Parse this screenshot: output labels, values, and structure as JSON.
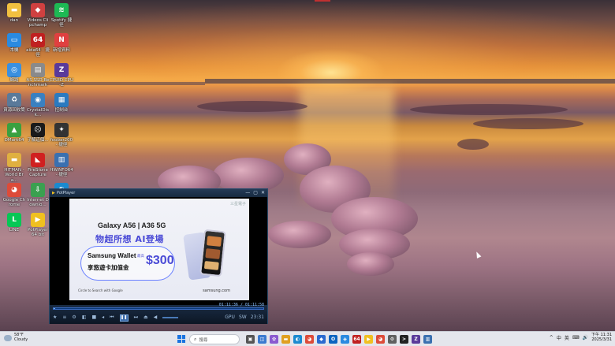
{
  "desktop": {
    "icons": [
      {
        "id": "folder-dan",
        "label": "dan",
        "icon": "folder-icon",
        "color": "#f2c040",
        "glyph": "▬"
      },
      {
        "id": "ms-store",
        "label": "Videos Clipchamp",
        "icon": "store-icon",
        "color": "#d04040",
        "glyph": "◆"
      },
      {
        "id": "spotify",
        "label": "Spotify\n捷徑",
        "icon": "spotify-icon",
        "color": "#1db954",
        "glyph": "≋"
      },
      {
        "id": "desktop-pc",
        "label": "本機",
        "icon": "computer-icon",
        "color": "#2a8ae0",
        "glyph": "▭"
      },
      {
        "id": "aida64",
        "label": "aida64 - 捷徑",
        "icon": "aida64-icon",
        "color": "#c02020",
        "glyph": "64"
      },
      {
        "id": "app-new",
        "label": "新增資料",
        "icon": "new-app-icon",
        "color": "#e04040",
        "glyph": "N"
      },
      {
        "id": "network",
        "label": "網路",
        "icon": "network-icon",
        "color": "#3a90e0",
        "glyph": "◎"
      },
      {
        "id": "as-ssd",
        "label": "AS SSD Benchmark",
        "icon": "ssd-icon",
        "color": "#8a8a8a",
        "glyph": "▤"
      },
      {
        "id": "cpuid",
        "label": "CPUID CPU-Z",
        "icon": "cpuz-icon",
        "color": "#5a3a9a",
        "glyph": "Z"
      },
      {
        "id": "recycle",
        "label": "資源回收筒",
        "icon": "recycle-bin-icon",
        "color": "#5a7a9a",
        "glyph": "♻"
      },
      {
        "id": "crystaldisk",
        "label": "CrystalDisk...",
        "icon": "crystaldisk-icon",
        "color": "#3a80c0",
        "glyph": "◉"
      },
      {
        "id": "control-panel",
        "label": "控制台",
        "icon": "control-panel-icon",
        "color": "#2a7ac0",
        "glyph": "▦"
      },
      {
        "id": "dmark",
        "label": "DMark64",
        "icon": "dmark-icon",
        "color": "#3aa040",
        "glyph": "▲"
      },
      {
        "id": "uninstall",
        "label": "了解這個...",
        "icon": "help-icon",
        "color": "#1a1a1a",
        "glyph": "☹"
      },
      {
        "id": "foobar",
        "label": "foobar200 - 捷徑",
        "icon": "foobar-icon",
        "color": "#333333",
        "glyph": "✦"
      },
      {
        "id": "hitman",
        "label": "HITMAN - World Bra...",
        "icon": "folder-icon",
        "color": "#e0b040",
        "glyph": "▬"
      },
      {
        "id": "firestone",
        "label": "FireStone Capture",
        "icon": "firestone-icon",
        "color": "#d02020",
        "glyph": "◣"
      },
      {
        "id": "hwinfo",
        "label": "HWiNFO64 - 捷徑",
        "icon": "hwinfo-icon",
        "color": "#3a70b0",
        "glyph": "▥"
      },
      {
        "id": "chrome",
        "label": "Google Chrome",
        "icon": "chrome-icon",
        "color": "#dd4b39",
        "glyph": "◕"
      },
      {
        "id": "idm",
        "label": "Internet Downlo...",
        "icon": "idm-icon",
        "color": "#3aa050",
        "glyph": "⇩"
      },
      {
        "id": "edge",
        "label": "Microsoft Edge",
        "icon": "edge-icon",
        "color": "#1a8ad0",
        "glyph": "◐"
      },
      {
        "id": "line",
        "label": "LINE",
        "icon": "line-icon",
        "color": "#06c755",
        "glyph": "L"
      },
      {
        "id": "potplayer",
        "label": "PotPlayer 64 bit",
        "icon": "potplayer-icon",
        "color": "#f0c020",
        "glyph": "▶"
      }
    ]
  },
  "player": {
    "title": "PotPlayer",
    "time": "01:11:36 / 01:11:58",
    "ad": {
      "corner": "三星電子",
      "model": "Galaxy A56 | A36 5G",
      "headline": "物超所想 AI登場",
      "wallet": "Samsung Wallet",
      "sub": "享悠遊卡加值金",
      "upto": "最高",
      "amount": "$300",
      "circle": "Circle to Search with Google",
      "site": "samsung.com"
    },
    "right_labels": [
      "GPU",
      "SW",
      "23:31"
    ]
  },
  "taskbar": {
    "weather_temp": "58°F",
    "weather_desc": "Cloudy",
    "search_placeholder": "搜尋",
    "apps": [
      {
        "icon": "task-view-icon",
        "color": "#555555",
        "glyph": "▣"
      },
      {
        "icon": "widgets-icon",
        "color": "#3a7ad0",
        "glyph": "◫"
      },
      {
        "icon": "copilot-icon",
        "color": "#8a5ad0",
        "glyph": "✿"
      },
      {
        "icon": "file-explorer-icon",
        "color": "#e0a020",
        "glyph": "▬"
      },
      {
        "icon": "edge-icon",
        "color": "#1a8ad0",
        "glyph": "◐"
      },
      {
        "icon": "chrome-icon",
        "color": "#dd4b39",
        "glyph": "◕"
      },
      {
        "icon": "store-icon",
        "color": "#2a6ad0",
        "glyph": "◆"
      },
      {
        "icon": "outlook-icon",
        "color": "#0a64c0",
        "glyph": "O"
      },
      {
        "icon": "photos-icon",
        "color": "#2a8ae0",
        "glyph": "◈"
      },
      {
        "icon": "aida64-icon",
        "color": "#c02020",
        "glyph": "64"
      },
      {
        "icon": "potplayer-icon",
        "color": "#f0c020",
        "glyph": "▶"
      },
      {
        "icon": "chrome-icon",
        "color": "#dd4b39",
        "glyph": "◕"
      },
      {
        "icon": "settings-icon",
        "color": "#606060",
        "glyph": "⚙"
      },
      {
        "icon": "terminal-icon",
        "color": "#222222",
        "glyph": ">"
      },
      {
        "icon": "cpuz-icon",
        "color": "#5a3a9a",
        "glyph": "Z"
      },
      {
        "icon": "hwinfo-icon",
        "color": "#3a70b0",
        "glyph": "▥"
      }
    ],
    "tray": [
      "^",
      "中",
      "英",
      "⌨",
      "🔊"
    ],
    "time": "下午 11:31",
    "date": "2025/3/31"
  }
}
